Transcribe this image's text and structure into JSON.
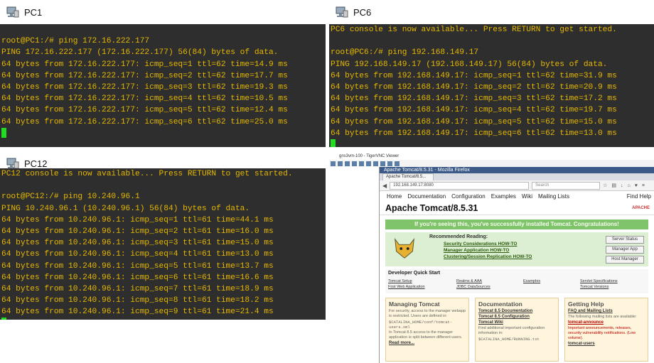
{
  "pc1": {
    "title": "PC1",
    "lines": [
      "",
      "root@PC1:/# ping 172.16.222.177",
      "PING 172.16.222.177 (172.16.222.177) 56(84) bytes of data.",
      "64 bytes from 172.16.222.177: icmp_seq=1 ttl=62 time=14.9 ms",
      "64 bytes from 172.16.222.177: icmp_seq=2 ttl=62 time=17.7 ms",
      "64 bytes from 172.16.222.177: icmp_seq=3 ttl=62 time=19.3 ms",
      "64 bytes from 172.16.222.177: icmp_seq=4 ttl=62 time=10.5 ms",
      "64 bytes from 172.16.222.177: icmp_seq=5 ttl=62 time=12.4 ms",
      "64 bytes from 172.16.222.177: icmp_seq=6 ttl=62 time=25.0 ms"
    ]
  },
  "pc6": {
    "title": "PC6",
    "lines": [
      "PC6 console is now available... Press RETURN to get started.",
      "",
      "root@PC6:/# ping 192.168.149.17",
      "PING 192.168.149.17 (192.168.149.17) 56(84) bytes of data.",
      "64 bytes from 192.168.149.17: icmp_seq=1 ttl=62 time=31.9 ms",
      "64 bytes from 192.168.149.17: icmp_seq=2 ttl=62 time=20.9 ms",
      "64 bytes from 192.168.149.17: icmp_seq=3 ttl=62 time=17.2 ms",
      "64 bytes from 192.168.149.17: icmp_seq=4 ttl=62 time=19.7 ms",
      "64 bytes from 192.168.149.17: icmp_seq=5 ttl=62 time=15.0 ms",
      "64 bytes from 192.168.149.17: icmp_seq=6 ttl=62 time=13.0 ms"
    ]
  },
  "pc12": {
    "title": "PC12",
    "lines": [
      "PC12 console is now available... Press RETURN to get started.",
      "",
      "root@PC12:/# ping 10.240.96.1",
      "PING 10.240.96.1 (10.240.96.1) 56(84) bytes of data.",
      "64 bytes from 10.240.96.1: icmp_seq=1 ttl=61 time=44.1 ms",
      "64 bytes from 10.240.96.1: icmp_seq=2 ttl=61 time=16.0 ms",
      "64 bytes from 10.240.96.1: icmp_seq=3 ttl=61 time=15.0 ms",
      "64 bytes from 10.240.96.1: icmp_seq=4 ttl=61 time=13.0 ms",
      "64 bytes from 10.240.96.1: icmp_seq=5 ttl=61 time=13.7 ms",
      "64 bytes from 10.240.96.1: icmp_seq=6 ttl=61 time=16.6 ms",
      "64 bytes from 10.240.96.1: icmp_seq=7 ttl=61 time=18.9 ms",
      "64 bytes from 10.240.96.1: icmp_seq=8 ttl=61 time=18.2 ms",
      "64 bytes from 10.240.96.1: icmp_seq=9 ttl=61 time=21.4 ms"
    ]
  },
  "vnc": {
    "window_title": "gns3vm-100 - TigerVNC Viewer",
    "firefox_title": "Apache Tomcat/8.5.31 - Mozilla Firefox",
    "tab_label": "Apache Tomcat/8.5...",
    "url": "192.168.149.17:8080",
    "search_placeholder": "Search",
    "nav": {
      "home": "Home",
      "documentation": "Documentation",
      "configuration": "Configuration",
      "examples": "Examples",
      "wiki": "Wiki",
      "mailing_lists": "Mailing Lists",
      "find_help": "Find Help"
    },
    "heading": "Apache Tomcat/8.5.31",
    "apache_logo": "APACHE",
    "banner": "If you're seeing this, you've successfully installed Tomcat. Congratulations!",
    "recommended": {
      "title": "Recommended Reading:",
      "links": [
        "Security Considerations HOW-TO",
        "Manager Application HOW-TO",
        "Clustering/Session Replication HOW-TO"
      ],
      "buttons": [
        "Server Status",
        "Manager App",
        "Host Manager"
      ]
    },
    "quick_start": {
      "title": "Developer Quick Start",
      "links": [
        "Tomcat Setup",
        "Realms & AAA",
        "Examples",
        "Servlet Specifications",
        "First Web Application",
        "JDBC DataSources",
        "Tomcat Versions"
      ]
    },
    "boxes": {
      "managing": {
        "title": "Managing Tomcat",
        "text1": "For security, access to the manager webapp is restricted. Users are defined in:",
        "code": "$CATALINA_HOME/conf/tomcat-users.xml",
        "text2": "In Tomcat 8.5 access to the manager application is split between different users.",
        "link": "Read more..."
      },
      "documentation": {
        "title": "Documentation",
        "link1": "Tomcat 8.5 Documentation",
        "link2": "Tomcat 8.5 Configuration",
        "link3": "Tomcat Wiki",
        "text": "Find additional important configuration information in:",
        "code": "$CATALINA_HOME/RUNNING.txt"
      },
      "help": {
        "title": "Getting Help",
        "link": "FAQ and Mailing Lists",
        "text": "The following mailing lists are available:",
        "announce": "tomcat-announce",
        "announce_text": "Important announcements, releases, security vulnerability notifications. (Low volume).",
        "users": "tomcat-users"
      }
    }
  }
}
